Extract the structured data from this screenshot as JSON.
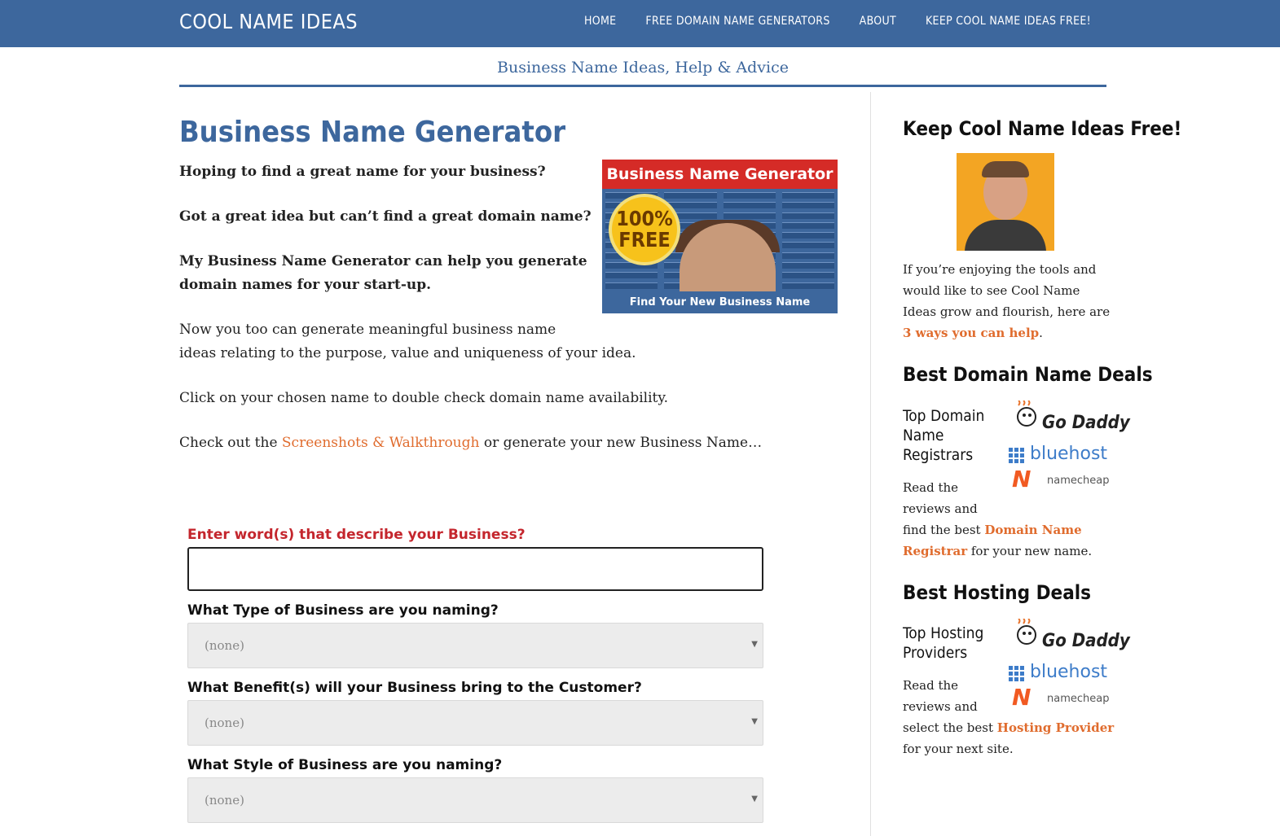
{
  "header": {
    "brand": "COOL NAME IDEAS",
    "nav": [
      "HOME",
      "FREE DOMAIN NAME GENERATORS",
      "ABOUT",
      "KEEP COOL NAME IDEAS FREE!"
    ]
  },
  "tagline": "Business Name Ideas, Help & Advice",
  "main": {
    "title": "Business Name Generator",
    "p1": "Hoping to find a great name for your business?",
    "p2": "Got a great idea but can’t find a great domain name?",
    "p3a": "My Business Name Generator can help you generate",
    "p3b": "domain names for your start-up.",
    "p4a": "Now you too can generate meaningful business name",
    "p4b": "ideas relating to the purpose, value and uniqueness of your idea.",
    "p5": "Click on your chosen name to double check domain name availability.",
    "p6_before": "Check out the ",
    "p6_link": "Screenshots & Walkthrough",
    "p6_after": " or generate your new Business Name…"
  },
  "promo": {
    "title": "Business Name Generator",
    "badge_top": "100%",
    "badge_bottom": "FREE",
    "cta": "Find Your New Business Name"
  },
  "form": {
    "keywords_label": "Enter word(s) that describe your Business?",
    "keywords_value": "",
    "type_label": "What Type of Business are you naming?",
    "type_value": "(none)",
    "benefit_label": "What Benefit(s) will your Business bring to the Customer?",
    "benefit_value": "(none)",
    "style_label": "What Style of Business are you naming?",
    "style_value": "(none)"
  },
  "sidebar": {
    "free_title": "Keep Cool Name Ideas Free!",
    "free_l1": "If you’re enjoying the tools and",
    "free_l2": "would like to see Cool Name",
    "free_l3": "Ideas grow and flourish, here are",
    "free_link": "3 ways you can help",
    "free_period": ".",
    "domain_title": "Best Domain Name Deals",
    "domain_sub_l1": "Top Domain",
    "domain_sub_l2": "Name",
    "domain_sub_l3": "Registrars",
    "domain_p_l1": "Read the",
    "domain_p_l2": "reviews and",
    "domain_p_l3": "find the best ",
    "domain_link_l1": "Domain Name",
    "domain_link_l2": "Registrar",
    "domain_p_end": " for your new name.",
    "hosting_title": "Best Hosting Deals",
    "hosting_sub_l1": "Top Hosting",
    "hosting_sub_l2": "Providers",
    "hosting_p_l1": "Read the",
    "hosting_p_l2": "reviews and",
    "hosting_p_l3": "select the best ",
    "hosting_link": "Hosting Provider",
    "hosting_p_l4": "for your next site.",
    "logos": {
      "godaddy": "Go Daddy",
      "bluehost": "bluehost",
      "namecheap": "namecheap"
    }
  },
  "colors": {
    "brand_blue": "#3d679d",
    "link_orange": "#e06c2e",
    "label_red": "#c4262d"
  }
}
